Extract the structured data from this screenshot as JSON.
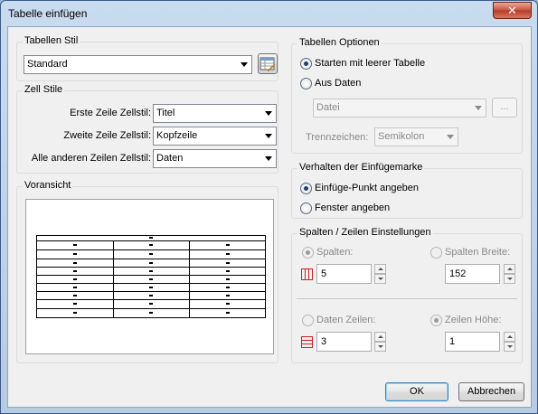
{
  "window": {
    "title": "Tabelle einfügen",
    "close_glyph": "✕"
  },
  "tabellen_stil": {
    "label": "Tabellen Stil",
    "selected": "Standard",
    "launcher_icon": "table-style-dialog-icon"
  },
  "zell_stile": {
    "label": "Zell Stile",
    "rows": [
      {
        "label": "Erste Zeile Zellstil:",
        "value": "Titel"
      },
      {
        "label": "Zweite Zeile Zellstil:",
        "value": "Kopfzeile"
      },
      {
        "label": "Alle anderen Zeilen Zellstil:",
        "value": "Daten"
      }
    ]
  },
  "voransicht": {
    "label": "Voransicht"
  },
  "tabellen_optionen": {
    "label": "Tabellen Optionen",
    "option_empty": "Starten mit leerer Tabelle",
    "option_data": "Aus Daten",
    "datei_placeholder": "Datei",
    "browse_label": "...",
    "trennzeichen_label": "Trennzeichen:",
    "trennzeichen_value": "Semikolon"
  },
  "einfuegemarke": {
    "label": "Verhalten der Einfügemarke",
    "option_point": "Einfüge-Punkt angeben",
    "option_window": "Fenster angeben"
  },
  "spalten_zeilen": {
    "label": "Spalten / Zeilen Einstellungen",
    "spalten_label": "Spalten:",
    "spalten_value": "5",
    "spalten_breite_label": "Spalten Breite:",
    "spalten_breite_value": "152",
    "daten_zeilen_label": "Daten Zeilen:",
    "daten_zeilen_value": "3",
    "zeilen_hoehe_label": "Zeilen Höhe:",
    "zeilen_hoehe_value": "1"
  },
  "buttons": {
    "ok": "OK",
    "cancel": "Abbrechen"
  },
  "colors": {
    "accent_icon": "#cc2222",
    "title_bar": "#c9dbef"
  }
}
